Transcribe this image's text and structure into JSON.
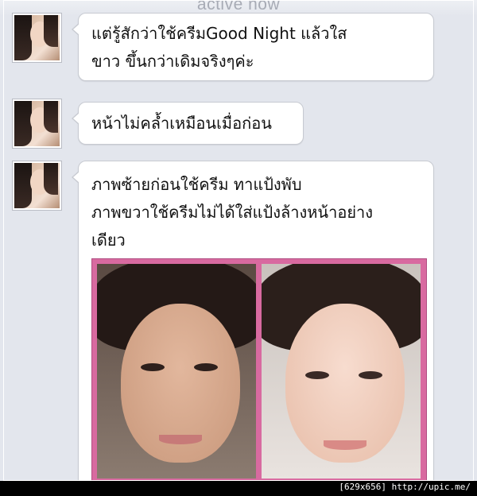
{
  "header": {
    "status": "active now"
  },
  "messages": [
    {
      "text": "แต่รู้สักว่าใช้ครีมGood Night แล้วใส\nขาว ขึ้นกว่าเดิมจริงๆค่ะ"
    },
    {
      "text": "หน้าไม่คล้ำเหมือนเมื่อก่อน"
    },
    {
      "text": "ภาพซ้ายก่อนใช้ครีม ทาแป้งพับ\nภาพขวาใช้ครีมไม่ได้ใส่แป้งล้างหน้าอย่าง\nเดียว"
    }
  ],
  "footer": {
    "caption": "[629x656] http://upic.me/"
  },
  "colors": {
    "background": "#e3e6ed",
    "bubble": "#ffffff",
    "photo_border": "#d86aa0"
  }
}
